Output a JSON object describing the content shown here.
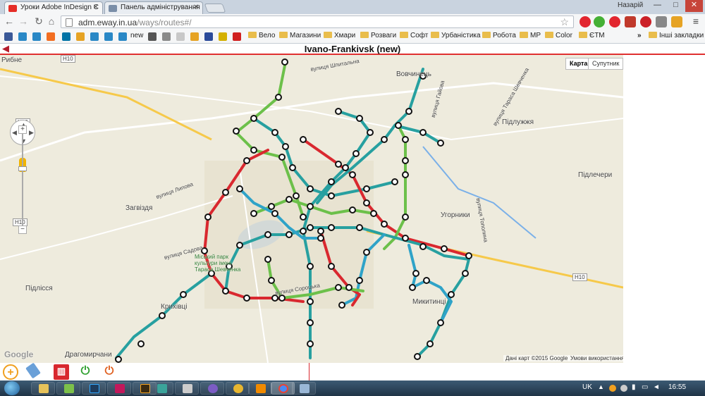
{
  "browser": {
    "tabs": [
      {
        "title": "Уроки Adobe InDesign C",
        "icon": "youtube-icon",
        "color": "#e52d27",
        "active": true
      },
      {
        "title": "Панель адміністрування",
        "icon": "page-icon",
        "color": "#7a8ea8",
        "active": false
      }
    ],
    "profile_name": "Назарій",
    "window_controls": {
      "minimize": "—",
      "maximize": "□",
      "close": "✕"
    },
    "url_host": "adm.eway.in.ua",
    "url_path": "/ways/routes#/",
    "bookmarks": [
      {
        "label": "new",
        "icon": "eye-icon"
      },
      {
        "label": "Вело",
        "icon": "folder-icon"
      },
      {
        "label": "Магазини",
        "icon": "folder-icon"
      },
      {
        "label": "Хмари",
        "icon": "folder-icon"
      },
      {
        "label": "Розваги",
        "icon": "folder-icon"
      },
      {
        "label": "Софт",
        "icon": "folder-icon"
      },
      {
        "label": "Урбаністика",
        "icon": "folder-icon"
      },
      {
        "label": "Робота",
        "icon": "folder-icon"
      },
      {
        "label": "МР",
        "icon": "folder-icon"
      },
      {
        "label": "Color",
        "icon": "folder-icon"
      },
      {
        "label": "ЄТМ",
        "icon": "folder-icon"
      }
    ],
    "bookmarks_overflow": "»",
    "other_bookmarks": "Інші закладки"
  },
  "app": {
    "title": "Ivano-Frankivsk (new)",
    "back_icon": "back-arrow-icon",
    "accent_color": "#e03030"
  },
  "map": {
    "type_buttons": [
      "Карта",
      "Супутник"
    ],
    "selected_type": "Карта",
    "place_names": [
      "Рибне",
      "Вовчинець",
      "Підлужжя",
      "Підлечери",
      "Загвіздя",
      "вулиця Липова",
      "Угорники",
      "вулиця Садова",
      "Міський парк культури імені Тараса Шевченка",
      "вулиця Сороцька",
      "Підлісся",
      "Крихівці",
      "Микитинці",
      "Драгомирчани",
      "вулиця Тополина",
      "вулиця Гайова",
      "вулиця Тараса Шевченка",
      "вулиця Шпитальна"
    ],
    "road_labels": [
      "H10",
      "H10",
      "H10",
      "H10"
    ],
    "attribution": "Дані карт ©2015 Google",
    "terms": "Умови використання",
    "google_logo": "Google",
    "route_colors": {
      "green": "#6cc04a",
      "teal": "#27a0a0",
      "red": "#d9282f",
      "blue": "#2fa3c8"
    },
    "zoom_in": "+",
    "zoom_out": "−"
  },
  "tools": [
    {
      "name": "add-route-button",
      "icon": "plus-circle-icon",
      "color": "#f0a020"
    },
    {
      "name": "eraser-button",
      "icon": "eraser-icon",
      "color": "#6aa0d8"
    },
    {
      "name": "delete-button",
      "icon": "trash-icon",
      "color": "#d8282f"
    },
    {
      "name": "power-on-button",
      "icon": "power-icon",
      "color": "#2ea02e"
    },
    {
      "name": "power-off-button",
      "icon": "power-icon",
      "color": "#e06020"
    }
  ],
  "taskbar": {
    "apps": [
      "explorer",
      "notepad-plus",
      "photoshop",
      "indesign",
      "illustrator",
      "stata",
      "viewer",
      "viber",
      "chrome-canary",
      "vlc",
      "chrome",
      "paint"
    ],
    "language": "UK",
    "time": "16:55"
  }
}
